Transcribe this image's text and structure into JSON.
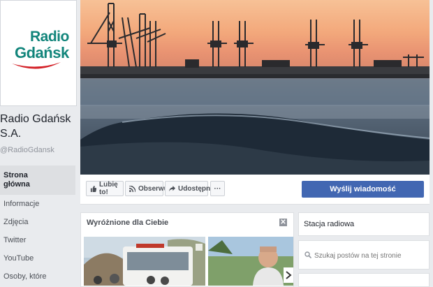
{
  "page": {
    "logo": {
      "line1": "Radio",
      "line2": "Gdańsk"
    },
    "name": "Radio Gdańsk S.A.",
    "handle": "@RadioGdansk"
  },
  "nav": {
    "items": [
      {
        "label": "Strona główna",
        "active": true
      },
      {
        "label": "Informacje"
      },
      {
        "label": "Zdjęcia"
      },
      {
        "label": "Twitter"
      },
      {
        "label": "YouTube"
      },
      {
        "label": "Osoby, które"
      }
    ]
  },
  "actions": {
    "like": "Lubię to!",
    "follow": "Obserwuj",
    "share": "Udostępnij",
    "more": "···",
    "send": "Wyślij wiadomość"
  },
  "featured": {
    "title": "Wyróżnione dla Ciebie",
    "close": "✕"
  },
  "sidebar": {
    "category": "Stacja radiowa",
    "search_placeholder": "Szukaj postów na tej stronie"
  },
  "colors": {
    "brand_blue": "#4267b2",
    "logo_teal": "#12857b",
    "logo_red": "#d32027",
    "background": "#e9ebee"
  },
  "icons": {
    "like": "thumbs-up-icon",
    "follow": "rss-icon",
    "share": "share-arrow-icon",
    "search": "search-icon",
    "next": "chevron-right-icon"
  }
}
